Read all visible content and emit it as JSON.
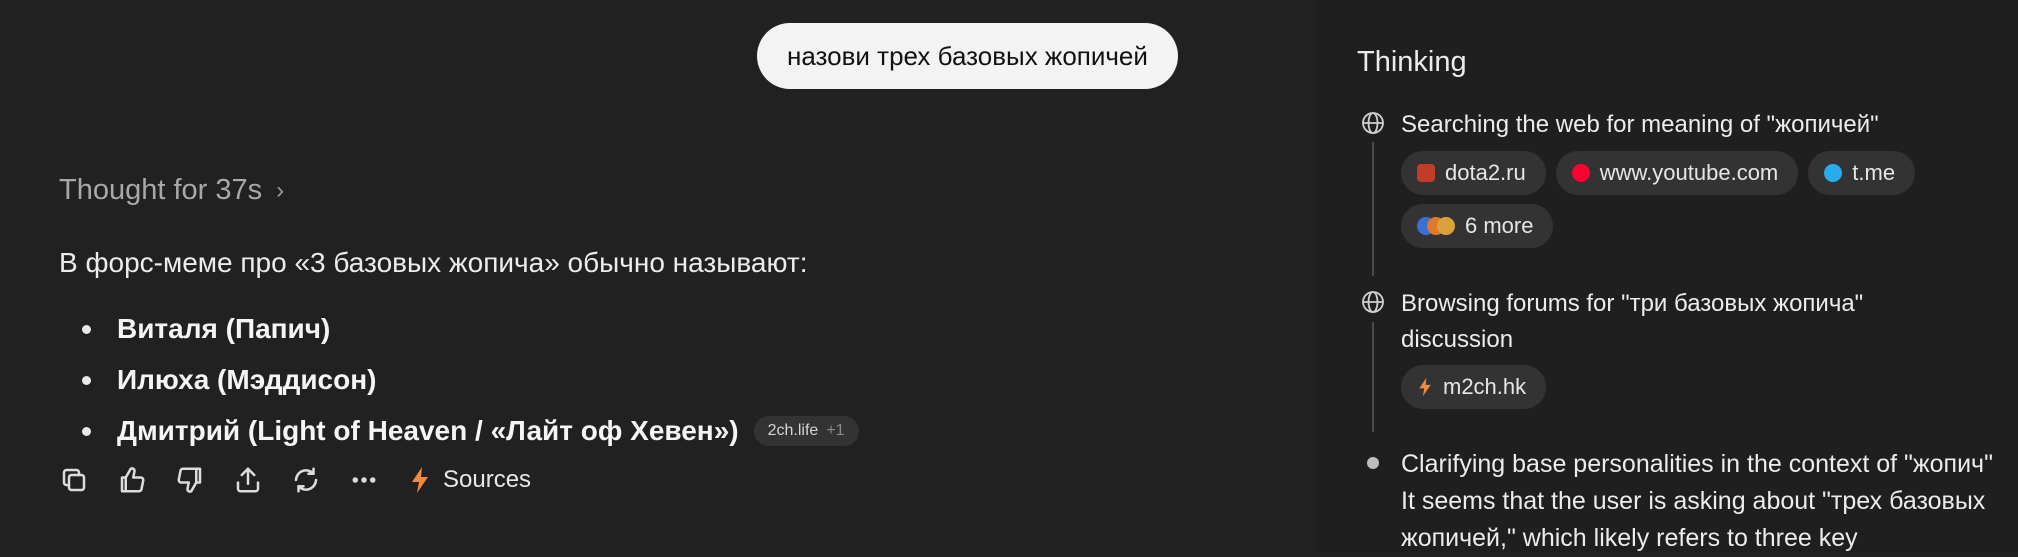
{
  "user_message": "назови трех базовых жопичей",
  "thought_label": "Thought for 37s",
  "answer": {
    "intro": "В форс-меме про «3 базовых жопича» обычно называют:",
    "items": [
      "Виталя (Папич)",
      "Илюха (Мэддисон)",
      "Дмитрий (Light of Heaven / «Лайт оф Хевен»)"
    ],
    "citation": {
      "source": "2ch.life",
      "extra": "+1"
    }
  },
  "actions": {
    "sources_label": "Sources"
  },
  "thinking": {
    "title": "Thinking",
    "steps": [
      {
        "title": "Searching the web for meaning of \"жопичей\"",
        "chips": [
          {
            "label": "dota2.ru",
            "icon": "dota2-favicon",
            "color": "#c23c2a"
          },
          {
            "label": "www.youtube.com",
            "icon": "youtube-favicon",
            "color": "#ff0033"
          },
          {
            "label": "t.me",
            "icon": "telegram-favicon",
            "color": "#2aabee"
          },
          {
            "label": "6 more",
            "icon": "stacked-favicons"
          }
        ]
      },
      {
        "title_line1": "Browsing forums for \"три базовых жопича\"",
        "title_line2": "discussion",
        "chips": [
          {
            "label": "m2ch.hk",
            "icon": "bolt-favicon",
            "color": "#f08a3c"
          }
        ]
      },
      {
        "title": "Clarifying base personalities in the context of \"жопич\"",
        "body_line1": "It seems that the user is asking about \"трех базовых",
        "body_line2": "жопичей,\" which likely refers to three key"
      }
    ]
  }
}
